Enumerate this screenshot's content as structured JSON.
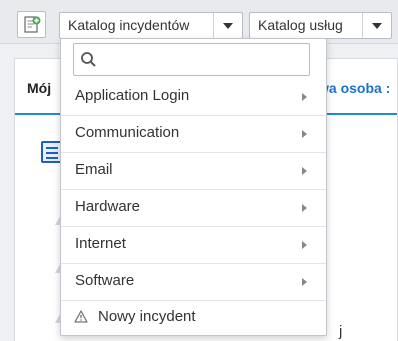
{
  "toolbar": {
    "new_icon": "new-document-icon",
    "incident_catalog_label": "Katalog incydentów",
    "service_catalog_label": "Katalog usług"
  },
  "tabs": {
    "active_label": "Mój",
    "link_label": "wa osoba :"
  },
  "background_text": "j",
  "dropdown": {
    "search": {
      "value": "",
      "placeholder": ""
    },
    "items": [
      {
        "label": "Application Login"
      },
      {
        "label": "Communication"
      },
      {
        "label": "Email"
      },
      {
        "label": "Hardware"
      },
      {
        "label": "Internet"
      },
      {
        "label": "Software"
      }
    ],
    "new_incident_label": "Nowy incydent",
    "new_incident_icon": "warning-icon"
  },
  "colors": {
    "accent": "#1f8ad1",
    "link": "#1a73c9"
  }
}
